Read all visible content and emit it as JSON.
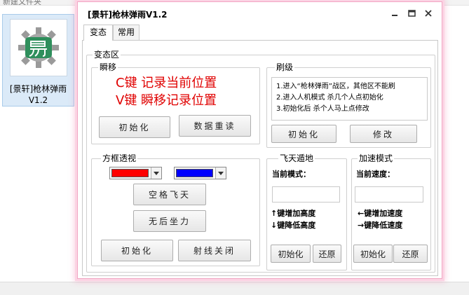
{
  "desktop": {
    "toolbar_text": "新建文件夹",
    "file": {
      "label_line1": "[景轩]枪林弹雨",
      "label_line2": "V1.2",
      "icon": "app-icon"
    }
  },
  "window": {
    "title": "[景轩]枪林弹雨V1.2",
    "controls": [
      "minimize-icon",
      "maximize-icon",
      "close-icon"
    ],
    "tabs": [
      {
        "label": "变态",
        "active": true
      },
      {
        "label": "常用",
        "active": false
      }
    ],
    "main": {
      "legend": "变态区",
      "teleport": {
        "legend": "瞬移",
        "line1": "C键 记录当前位置",
        "line2": "V键 瞬移记录位置",
        "init_button": "初始化",
        "reread_button": "数据重读"
      },
      "brush": {
        "legend": "刷级",
        "line1": "1.进入“枪林弹雨”战区，其他区不能刷",
        "line2": "2.进入人机模式 杀几个人点初始化",
        "line3": "3.初始化后 杀个人马上点修改",
        "init_button": "初始化",
        "modify_button": "修改"
      },
      "box": {
        "legend": "方框透视",
        "color1": "#ff0000",
        "color2": "#0000ff",
        "space_fly_button": "空格飞天",
        "no_recoil_button": "无后坐力",
        "init_button": "初始化",
        "ray_off_button": "射线关闭"
      },
      "fly": {
        "legend": "飞天遁地",
        "mode_label": "当前模式：",
        "mode_value": "",
        "up_hint": "↑键增加高度",
        "down_hint": "↓键降低高度",
        "init_button": "初始化",
        "restore_button": "还原"
      },
      "speed": {
        "legend": "加速模式",
        "speed_label": "当前速度：",
        "speed_value": "",
        "up_hint": "←键增加速度",
        "down_hint": "→键降低速度",
        "init_button": "初始化",
        "restore_button": "还原"
      }
    }
  }
}
